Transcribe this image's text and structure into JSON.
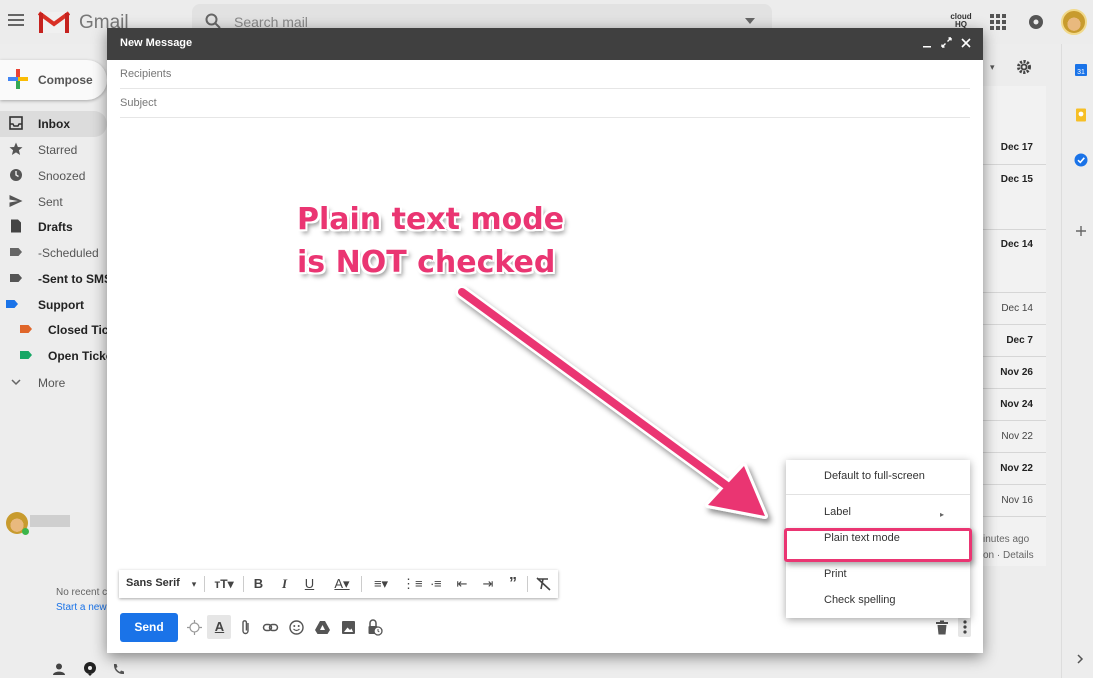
{
  "header": {
    "app_name": "Gmail",
    "search_placeholder": "Search mail",
    "support_logo": "cloud HQ"
  },
  "sidebar": {
    "compose_label": "Compose",
    "items": [
      {
        "label": "Inbox",
        "bold": true
      },
      {
        "label": "Starred"
      },
      {
        "label": "Snoozed"
      },
      {
        "label": "Sent"
      },
      {
        "label": "Drafts",
        "bold": true
      },
      {
        "label": "-Scheduled"
      },
      {
        "label": "-Sent to SMS",
        "bold": true
      },
      {
        "label": "Support",
        "bold": true
      },
      {
        "label": "Closed Tick",
        "bold": true
      },
      {
        "label": "Open Ticke",
        "bold": true
      },
      {
        "label": "More"
      }
    ],
    "hangouts_no_recent": "No recent c",
    "hangouts_start_new": "Start a new"
  },
  "email_list": {
    "dates": [
      {
        "date": "Dec 17",
        "bold": true
      },
      {
        "date": "Dec 15",
        "bold": true
      },
      {
        "date": "Dec 14",
        "bold": true
      },
      {
        "date": "Dec 14",
        "bold": false
      },
      {
        "date": "Dec 7",
        "bold": true
      },
      {
        "date": "Nov 26",
        "bold": true
      },
      {
        "date": "Nov 24",
        "bold": true
      },
      {
        "date": "Nov 22",
        "bold": false
      },
      {
        "date": "Nov 22",
        "bold": true
      },
      {
        "date": "Nov 16",
        "bold": false
      }
    ],
    "footer_line1": "inutes ago",
    "footer_line2": "on · Details"
  },
  "compose": {
    "title": "New Message",
    "recipients_placeholder": "Recipients",
    "subject_placeholder": "Subject",
    "font_family": "Sans Serif",
    "send_label": "Send"
  },
  "more_options_menu": {
    "items": [
      {
        "label": "Default to full-screen"
      },
      {
        "label": "Label",
        "has_submenu": true
      },
      {
        "label": "Plain text mode",
        "checked": false,
        "highlighted": true
      },
      {
        "label": "Print"
      },
      {
        "label": "Check spelling"
      }
    ]
  },
  "annotation": {
    "line1": "Plain text mode",
    "line2": "is NOT checked",
    "color": "#ea3572"
  },
  "colors": {
    "accent": "#1a73e8",
    "dialog_header": "#404040",
    "gmail_red": "#d93025"
  }
}
